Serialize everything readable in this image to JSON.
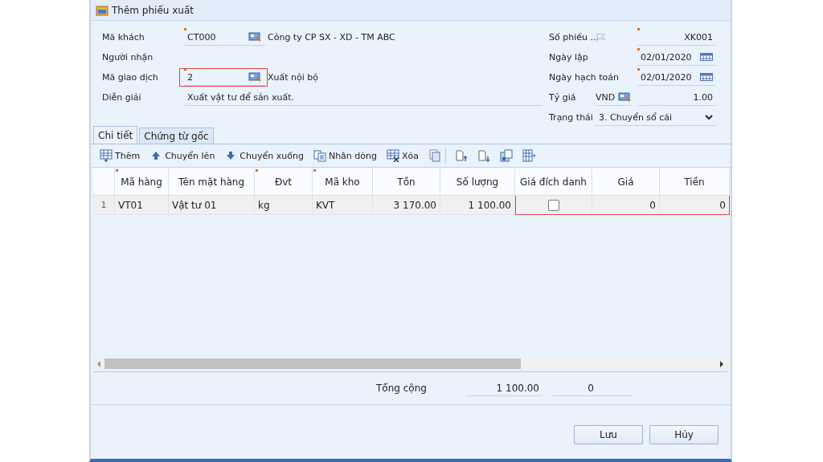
{
  "window": {
    "title": "Thêm phiếu xuất"
  },
  "form_left": [
    {
      "label": "Mã khách",
      "kind": "lookup",
      "value": "CT000",
      "required": true,
      "highlighted": false,
      "description": "Công ty CP SX - XD - TM ABC"
    },
    {
      "label": "Người nhận",
      "kind": "none",
      "required": false,
      "highlighted": false
    },
    {
      "label": "Mã giao dịch",
      "kind": "lookup",
      "value": "2",
      "required": true,
      "highlighted": true,
      "description": "Xuất nội bộ"
    },
    {
      "label": "Diễn giải",
      "kind": "text",
      "value": "Xuất vật tư để sản xuất.",
      "required": false,
      "highlighted": false
    }
  ],
  "form_right": [
    {
      "label": "Số phiếu ...",
      "kind": "flagged",
      "value": "XK001",
      "required": true
    },
    {
      "label": "Ngày lập",
      "kind": "date",
      "value": "02/01/2020",
      "required": true
    },
    {
      "label": "Ngày hạch toán",
      "kind": "date",
      "value": "02/01/2020",
      "required": true
    },
    {
      "label": "Tỷ giá",
      "kind": "currency",
      "currency": "VND",
      "value": "1.00",
      "required": false
    },
    {
      "label": "Trạng thái",
      "kind": "select",
      "value": "3. Chuyển sổ cái",
      "required": false
    }
  ],
  "tabs": [
    {
      "label": "Chi tiết",
      "selected": true
    },
    {
      "label": "Chứng từ gốc",
      "selected": false
    }
  ],
  "toolbar": [
    {
      "kind": "add",
      "label": "Thêm"
    },
    {
      "kind": "up",
      "label": "Chuyển lên"
    },
    {
      "kind": "down",
      "label": "Chuyển xuống"
    },
    {
      "kind": "duplicate",
      "label": "Nhân dòng"
    },
    {
      "kind": "delete",
      "label": "Xóa"
    },
    {
      "kind": "copy"
    },
    {
      "kind": "insert-above"
    },
    {
      "kind": "insert-below"
    },
    {
      "kind": "export"
    },
    {
      "kind": "columns"
    }
  ],
  "columns": [
    {
      "label": "Mã hàng",
      "kind": "text",
      "required": true,
      "highlighted": false
    },
    {
      "label": "Tên mặt hàng",
      "kind": "text",
      "required": false,
      "highlighted": false
    },
    {
      "label": "Đvt",
      "kind": "text",
      "required": true,
      "highlighted": false
    },
    {
      "label": "Mã kho",
      "kind": "text",
      "required": true,
      "highlighted": false
    },
    {
      "label": "Tồn",
      "kind": "number",
      "required": false,
      "highlighted": false
    },
    {
      "label": "Số lượng",
      "kind": "number",
      "required": false,
      "highlighted": false
    },
    {
      "label": "Giá đích danh",
      "kind": "check",
      "required": false,
      "highlighted": true
    },
    {
      "label": "Giá",
      "kind": "number",
      "required": false,
      "highlighted": true
    },
    {
      "label": "Tiền",
      "kind": "number",
      "required": false,
      "highlighted": true
    }
  ],
  "rows": [
    {
      "number": "1",
      "cells": [
        {
          "text": "VT01"
        },
        {
          "text": "Vật tư 01"
        },
        {
          "text": "kg"
        },
        {
          "text": "KVT"
        },
        {
          "text": "3 170.00"
        },
        {
          "text": "1 100.00"
        },
        {
          "checked": false
        },
        {
          "text": "0"
        },
        {
          "text": "0"
        }
      ]
    }
  ],
  "totals": {
    "label": "Tổng cộng",
    "values": [
      "1 100.00",
      "0"
    ]
  },
  "buttons": [
    {
      "label": "Lưu"
    },
    {
      "label": "Hủy"
    }
  ]
}
